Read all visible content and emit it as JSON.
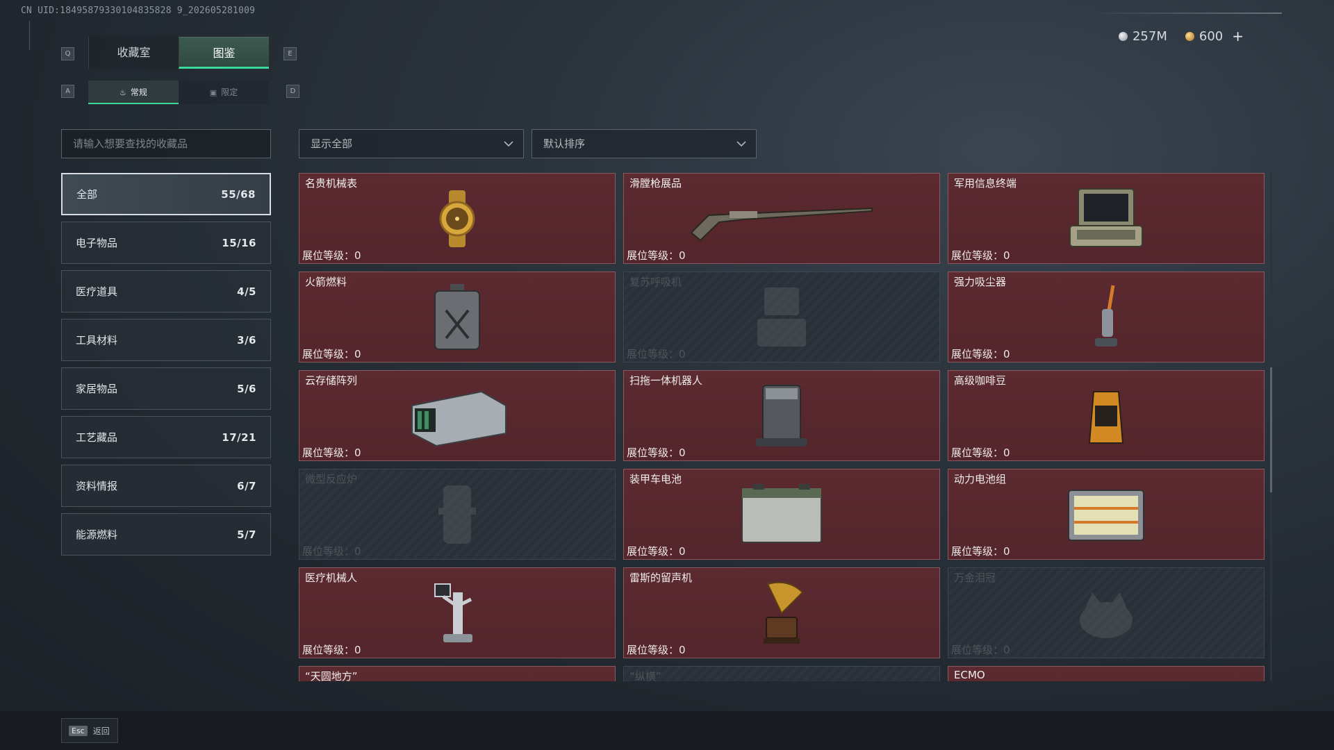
{
  "uid": "CN UID:18495879330104835828 9_202605281009",
  "keys": {
    "q": "Q",
    "e": "E",
    "a": "A",
    "d": "D"
  },
  "tabs": {
    "main": [
      {
        "label": "收藏室"
      },
      {
        "label": "图鉴"
      }
    ],
    "sub": [
      {
        "label": "常规"
      },
      {
        "label": "限定"
      }
    ]
  },
  "currency": {
    "silver": "257M",
    "gold": "600",
    "plus": "+"
  },
  "search": {
    "placeholder": "请输入想要查找的收藏品"
  },
  "filters": {
    "show": "显示全部",
    "sort": "默认排序"
  },
  "categories": [
    {
      "label": "全部",
      "count": "55/68"
    },
    {
      "label": "电子物品",
      "count": "15/16"
    },
    {
      "label": "医疗道具",
      "count": "4/5"
    },
    {
      "label": "工具材料",
      "count": "3/6"
    },
    {
      "label": "家居物品",
      "count": "5/6"
    },
    {
      "label": "工艺藏品",
      "count": "17/21"
    },
    {
      "label": "资料情报",
      "count": "6/7"
    },
    {
      "label": "能源燃料",
      "count": "5/7"
    }
  ],
  "level_label": "展位等级：",
  "items": [
    {
      "name": "名贵机械表",
      "level": "0",
      "icon": "watch-icon"
    },
    {
      "name": "滑膛枪展品",
      "level": "0",
      "icon": "musket-icon"
    },
    {
      "name": "军用信息终端",
      "level": "0",
      "icon": "terminal-icon"
    },
    {
      "name": "火箭燃料",
      "level": "0",
      "icon": "fuel-can-icon"
    },
    {
      "name": "复苏呼吸机",
      "level": "0",
      "icon": "ventilator-icon"
    },
    {
      "name": "强力吸尘器",
      "level": "0",
      "icon": "vacuum-icon"
    },
    {
      "name": "云存储阵列",
      "level": "0",
      "icon": "storage-array-icon"
    },
    {
      "name": "扫拖一体机器人",
      "level": "0",
      "icon": "robot-vacuum-icon"
    },
    {
      "name": "高级咖啡豆",
      "level": "0",
      "icon": "coffee-bag-icon"
    },
    {
      "name": "微型反应炉",
      "level": "0",
      "icon": "reactor-icon"
    },
    {
      "name": "装甲车电池",
      "level": "0",
      "icon": "battery-icon"
    },
    {
      "name": "动力电池组",
      "level": "0",
      "icon": "battery-pack-icon"
    },
    {
      "name": "医疗机械人",
      "level": "0",
      "icon": "medical-robot-icon"
    },
    {
      "name": "雷斯的留声机",
      "level": "0",
      "icon": "gramophone-icon"
    },
    {
      "name": "万金泪冠",
      "level": "0",
      "icon": "crown-icon"
    },
    {
      "name": "“天圆地方”",
      "level": "",
      "icon": ""
    },
    {
      "name": "“纵横”",
      "level": "",
      "icon": ""
    },
    {
      "name": "ECMO",
      "level": "",
      "icon": ""
    }
  ],
  "footer": {
    "esc_key": "Esc",
    "back": "返回"
  },
  "colors": {
    "card_owned": "#5c2a31",
    "accent": "#38d99a",
    "card_locked": "#2a3037"
  }
}
